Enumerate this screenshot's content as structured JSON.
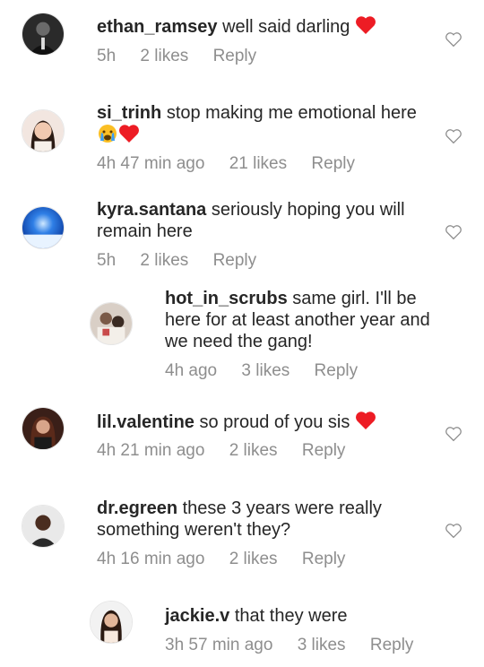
{
  "comments": [
    {
      "username": "ethan_ramsey",
      "text": "well said darling",
      "emoji": "heart",
      "time": "5h",
      "likes": "2 likes",
      "reply": "Reply"
    },
    {
      "username": "si_trinh",
      "text": "stop making me emotional here",
      "emoji": "crying-face heart",
      "time": "4h 47 min ago",
      "likes": "21 likes",
      "reply": "Reply"
    },
    {
      "username": "kyra.santana",
      "text": "seriously hoping you will remain here",
      "time": "5h",
      "likes": "2 likes",
      "reply": "Reply"
    },
    {
      "username": "hot_in_scrubs",
      "text": "same girl. I'll be here for at least another year and we need the gang!",
      "time": "4h ago",
      "likes": "3 likes",
      "reply": "Reply"
    },
    {
      "username": "lil.valentine",
      "text": "so proud of you sis",
      "emoji": "heart",
      "time": "4h 21 min ago",
      "likes": "2 likes",
      "reply": "Reply"
    },
    {
      "username": "dr.egreen",
      "text": "these 3 years were really something weren't they?",
      "time": "4h 16 min ago",
      "likes": "2 likes",
      "reply": "Reply"
    },
    {
      "username": "jackie.v",
      "text": "that they were",
      "time": "3h 57 min ago",
      "likes": "3 likes",
      "reply": "Reply"
    }
  ],
  "colors": {
    "heart": "#ed1c24",
    "secondary_text": "#8e8e8e",
    "text": "#262626"
  }
}
